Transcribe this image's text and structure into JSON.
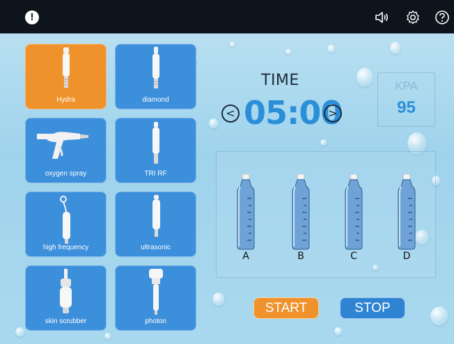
{
  "topbar": {
    "icons": [
      "alert-icon",
      "volume-icon",
      "settings-icon",
      "help-icon"
    ],
    "background": "#0d141c"
  },
  "handpieces": [
    {
      "label": "Hydra",
      "active": true
    },
    {
      "label": "diamond",
      "active": false
    },
    {
      "label": "oxygen spray",
      "active": false
    },
    {
      "label": "TRI RF",
      "active": false
    },
    {
      "label": "high frequency",
      "active": false
    },
    {
      "label": "ultrasonic",
      "active": false
    },
    {
      "label": "skin scrubber",
      "active": false
    },
    {
      "label": "photon",
      "active": false
    }
  ],
  "timer": {
    "title": "TIME",
    "value": "05:00",
    "prev": "<",
    "next": ">"
  },
  "kpa": {
    "label": "KPA",
    "value": "95"
  },
  "bottles": [
    {
      "label": "A"
    },
    {
      "label": "B"
    },
    {
      "label": "C"
    },
    {
      "label": "D"
    }
  ],
  "controls": {
    "start_label": "START",
    "stop_label": "STOP"
  },
  "colors": {
    "accent_orange": "#f0922b",
    "accent_blue": "#3c8fdb",
    "value_blue": "#2a8fd8"
  }
}
